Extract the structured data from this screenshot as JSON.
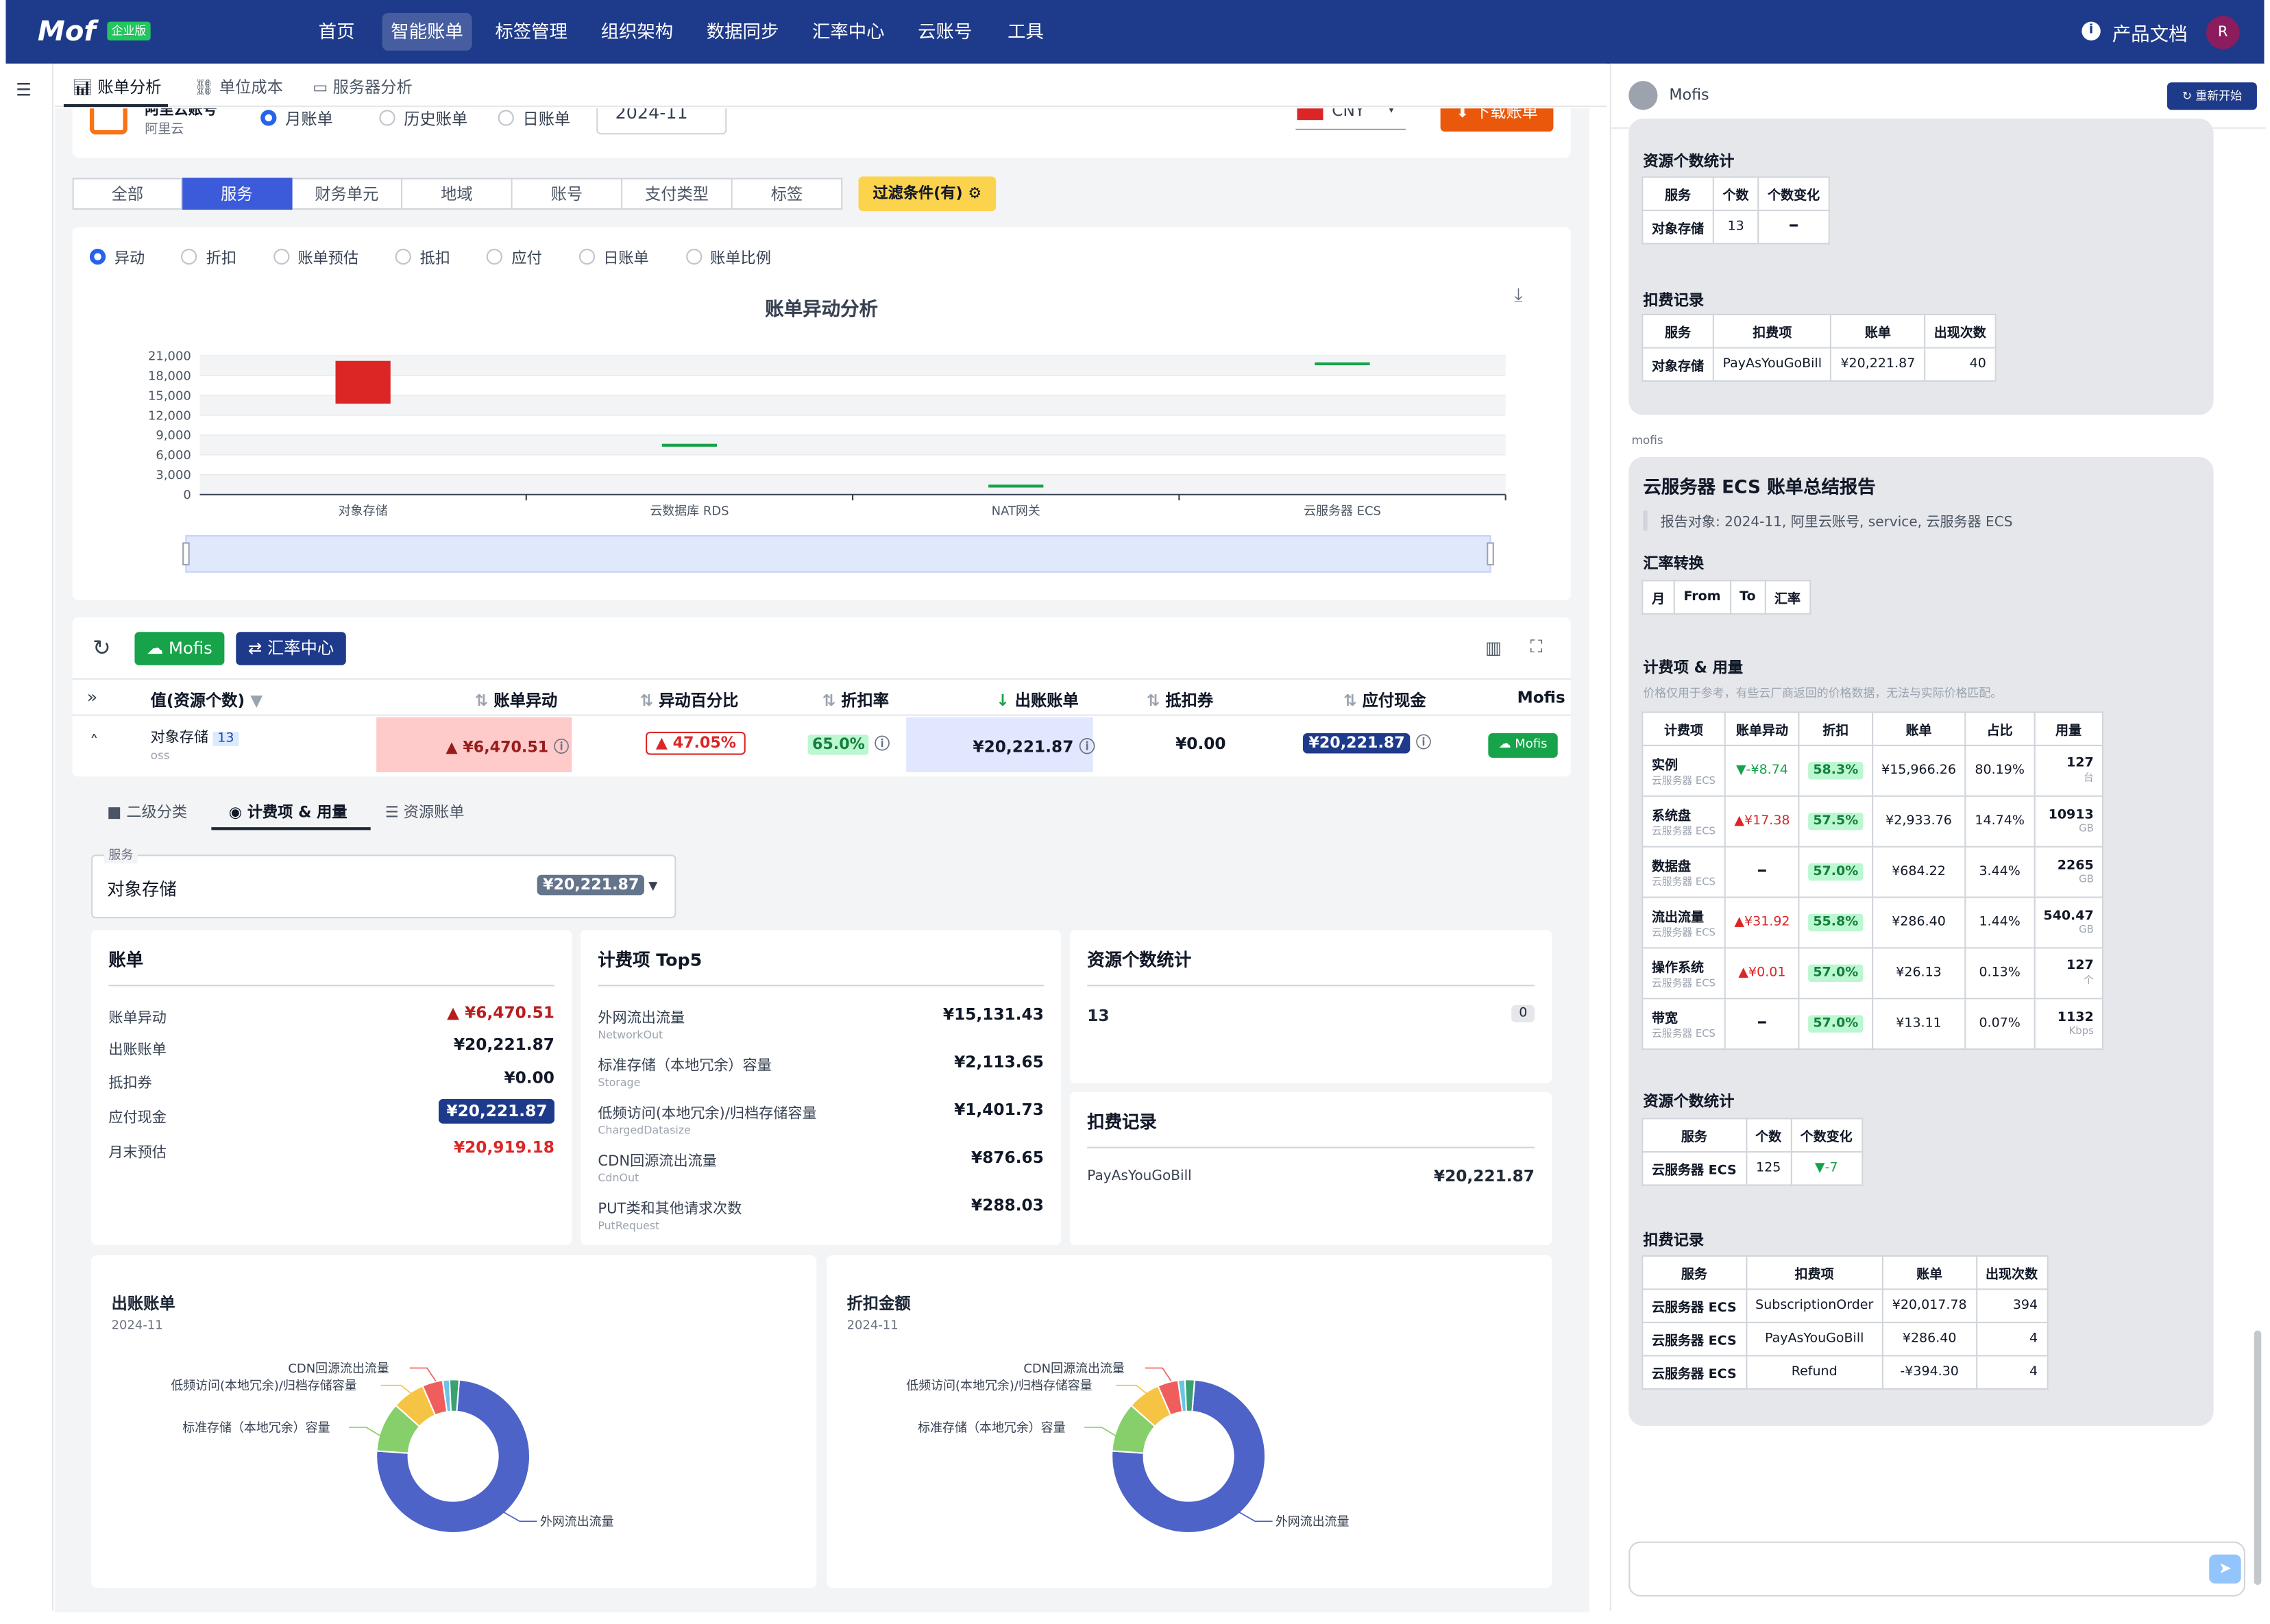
{
  "app": {
    "logo": "Mof",
    "badge": "企业版",
    "nav": [
      "首页",
      "智能账单",
      "标签管理",
      "组织架构",
      "数据同步",
      "汇率中心",
      "云账号",
      "工具"
    ],
    "docs": "产品文档",
    "avatar": "R"
  },
  "subtabs": [
    "账单分析",
    "单位成本",
    "服务器分析"
  ],
  "header": {
    "account_name": "阿里云账号",
    "account_sub": "阿里云",
    "bill_types": [
      "月账单",
      "历史账单",
      "日账单"
    ],
    "month": "2024-11",
    "currency": "CNY",
    "download": "下载账单"
  },
  "dims": [
    "全部",
    "服务",
    "财务单元",
    "地域",
    "账号",
    "支付类型",
    "标签"
  ],
  "filter_btn": "过滤条件(有)",
  "chart_modes": [
    "异动",
    "折扣",
    "账单预估",
    "抵扣",
    "应付",
    "日账单",
    "账单比例"
  ],
  "chart_data": {
    "type": "bar",
    "title": "账单异动分析",
    "categories": [
      "对象存储",
      "云数据库 RDS",
      "NAT网关",
      "云服务器 ECS"
    ],
    "yticks": [
      "21,000",
      "18,000",
      "15,000",
      "12,000",
      "9,000",
      "6,000",
      "3,000",
      "0"
    ],
    "ylim": [
      0,
      21000
    ],
    "bars": [
      {
        "category": "对象存储",
        "from": 13751,
        "to": 20221,
        "color": "#dc2626"
      },
      {
        "category": "云数据库 RDS",
        "from": 7680,
        "to": 7680,
        "color": "#16a34a"
      },
      {
        "category": "NAT网关",
        "from": 1500,
        "to": 1500,
        "color": "#16a34a"
      },
      {
        "category": "云服务器 ECS",
        "from": 20000,
        "to": 20000,
        "color": "#16a34a"
      }
    ]
  },
  "toolbar": {
    "mofis": "Mofis",
    "exchange": "汇率中心"
  },
  "table": {
    "headers": [
      "值(资源个数)",
      "账单异动",
      "异动百分比",
      "折扣率",
      "出账账单",
      "抵扣券",
      "应付现金",
      "Mofis"
    ],
    "row": {
      "name": "对象存储",
      "count": "13",
      "code": "oss",
      "change": "¥6,470.51",
      "pct": "47.05%",
      "discount": "65.0%",
      "bill": "¥20,221.87",
      "coupon": "¥0.00",
      "cash": "¥20,221.87",
      "mofis": "Mofis"
    }
  },
  "detail_tabs": [
    "二级分类",
    "计费项 & 用量",
    "资源账单"
  ],
  "service_select": {
    "label": "服务",
    "value": "对象存储",
    "amount": "¥20,221.87"
  },
  "bill_card": {
    "title": "账单",
    "rows": [
      {
        "label": "账单异动",
        "value": "▲ ¥6,470.51"
      },
      {
        "label": "出账账单",
        "value": "¥20,221.87"
      },
      {
        "label": "抵扣券",
        "value": "¥0.00"
      },
      {
        "label": "应付现金",
        "value": "¥20,221.87"
      },
      {
        "label": "月末预估",
        "value": "¥20,919.18"
      }
    ]
  },
  "top5": {
    "title": "计费项 Top5",
    "items": [
      {
        "name": "外网流出流量",
        "sub": "NetworkOut",
        "value": "¥15,131.43"
      },
      {
        "name": "标准存储（本地冗余）容量",
        "sub": "Storage",
        "value": "¥2,113.65"
      },
      {
        "name": "低频访问(本地冗余)/归档存储容量",
        "sub": "ChargedDatasize",
        "value": "¥1,401.73"
      },
      {
        "name": "CDN回源流出流量",
        "sub": "CdnOut",
        "value": "¥876.65"
      },
      {
        "name": "PUT类和其他请求次数",
        "sub": "PutRequest",
        "value": "¥288.03"
      }
    ]
  },
  "res_card": {
    "title": "资源个数统计",
    "count": "13",
    "delta": "0"
  },
  "deduct_card": {
    "title": "扣费记录",
    "item": "PayAsYouGoBill",
    "value": "¥20,221.87"
  },
  "donut1": {
    "title": "出账账单",
    "date": "2024-11",
    "labels": [
      "CDN回源流出流量",
      "低频访问(本地冗余)/归档存储容量",
      "标准存储（本地冗余）容量",
      "外网流出流量"
    ]
  },
  "donut2": {
    "title": "折扣金额",
    "date": "2024-11",
    "labels": [
      "CDN回源流出流量",
      "低频访问(本地冗余)/归档存储容量",
      "标准存储（本地冗余）容量",
      "外网流出流量"
    ]
  },
  "donut_values": [
    {
      "name": "外网流出流量",
      "value": 15131.43,
      "color": "#4e63c7"
    },
    {
      "name": "标准存储（本地冗余）容量",
      "value": 2113.65,
      "color": "#86cf6b"
    },
    {
      "name": "低频访问(本地冗余)/归档存储容量",
      "value": 1401.73,
      "color": "#f6c445"
    },
    {
      "name": "CDN回源流出流量",
      "value": 876.65,
      "color": "#ef5d5d"
    },
    {
      "name": "PUT类和其他请求次数",
      "value": 288.03,
      "color": "#6bc4e4"
    },
    {
      "name": "其他",
      "value": 410.38,
      "color": "#3aa272"
    }
  ],
  "panel": {
    "title": "Mofis",
    "restart": "重新开始",
    "sender": "mofis",
    "b1": {
      "res_title": "资源个数统计",
      "res_headers": [
        "服务",
        "个数",
        "个数变化"
      ],
      "res_row": [
        "对象存储",
        "13",
        "━"
      ],
      "ded_title": "扣费记录",
      "ded_headers": [
        "服务",
        "扣费项",
        "账单",
        "出现次数"
      ],
      "ded_row": [
        "对象存储",
        "PayAsYouGoBill",
        "¥20,221.87",
        "40"
      ]
    },
    "b2": {
      "title": "云服务器 ECS 账单总结报告",
      "quote": "报告对象: 2024-11, 阿里云账号, service, 云服务器 ECS",
      "fx_title": "汇率转换",
      "fx_headers": [
        "月",
        "From",
        "To",
        "汇率"
      ],
      "items_title": "计费项 & 用量",
      "items_note": "价格仅用于参考，有些云厂商返回的价格数据，无法与实际价格匹配。",
      "items_headers": [
        "计费项",
        "账单异动",
        "折扣",
        "账单",
        "占比",
        "用量"
      ],
      "items": [
        {
          "name": "实例",
          "sub": "云服务器 ECS",
          "change": "▼-¥8.74",
          "disc": "58.3%",
          "bill": "¥15,966.26",
          "pct": "80.19%",
          "usage": "127",
          "unit": "台"
        },
        {
          "name": "系统盘",
          "sub": "云服务器 ECS",
          "change": "▲¥17.38",
          "disc": "57.5%",
          "bill": "¥2,933.76",
          "pct": "14.74%",
          "usage": "10913",
          "unit": "GB"
        },
        {
          "name": "数据盘",
          "sub": "云服务器 ECS",
          "change": "━",
          "disc": "57.0%",
          "bill": "¥684.22",
          "pct": "3.44%",
          "usage": "2265",
          "unit": "GB"
        },
        {
          "name": "流出流量",
          "sub": "云服务器 ECS",
          "change": "▲¥31.92",
          "disc": "55.8%",
          "bill": "¥286.40",
          "pct": "1.44%",
          "usage": "540.47",
          "unit": "GB"
        },
        {
          "name": "操作系统",
          "sub": "云服务器 ECS",
          "change": "▲¥0.01",
          "disc": "57.0%",
          "bill": "¥26.13",
          "pct": "0.13%",
          "usage": "127",
          "unit": "个"
        },
        {
          "name": "带宽",
          "sub": "云服务器 ECS",
          "change": "━",
          "disc": "57.0%",
          "bill": "¥13.11",
          "pct": "0.07%",
          "usage": "1132",
          "unit": "Kbps"
        }
      ],
      "res_title": "资源个数统计",
      "res_headers": [
        "服务",
        "个数",
        "个数变化"
      ],
      "res_row": [
        "云服务器 ECS",
        "125",
        "▼-7"
      ],
      "ded_title": "扣费记录",
      "ded_headers": [
        "服务",
        "扣费项",
        "账单",
        "出现次数"
      ],
      "ded_rows": [
        [
          "云服务器 ECS",
          "SubscriptionOrder",
          "¥20,017.78",
          "394"
        ],
        [
          "云服务器 ECS",
          "PayAsYouGoBill",
          "¥286.40",
          "4"
        ],
        [
          "云服务器 ECS",
          "Refund",
          "-¥394.30",
          "4"
        ]
      ]
    }
  }
}
